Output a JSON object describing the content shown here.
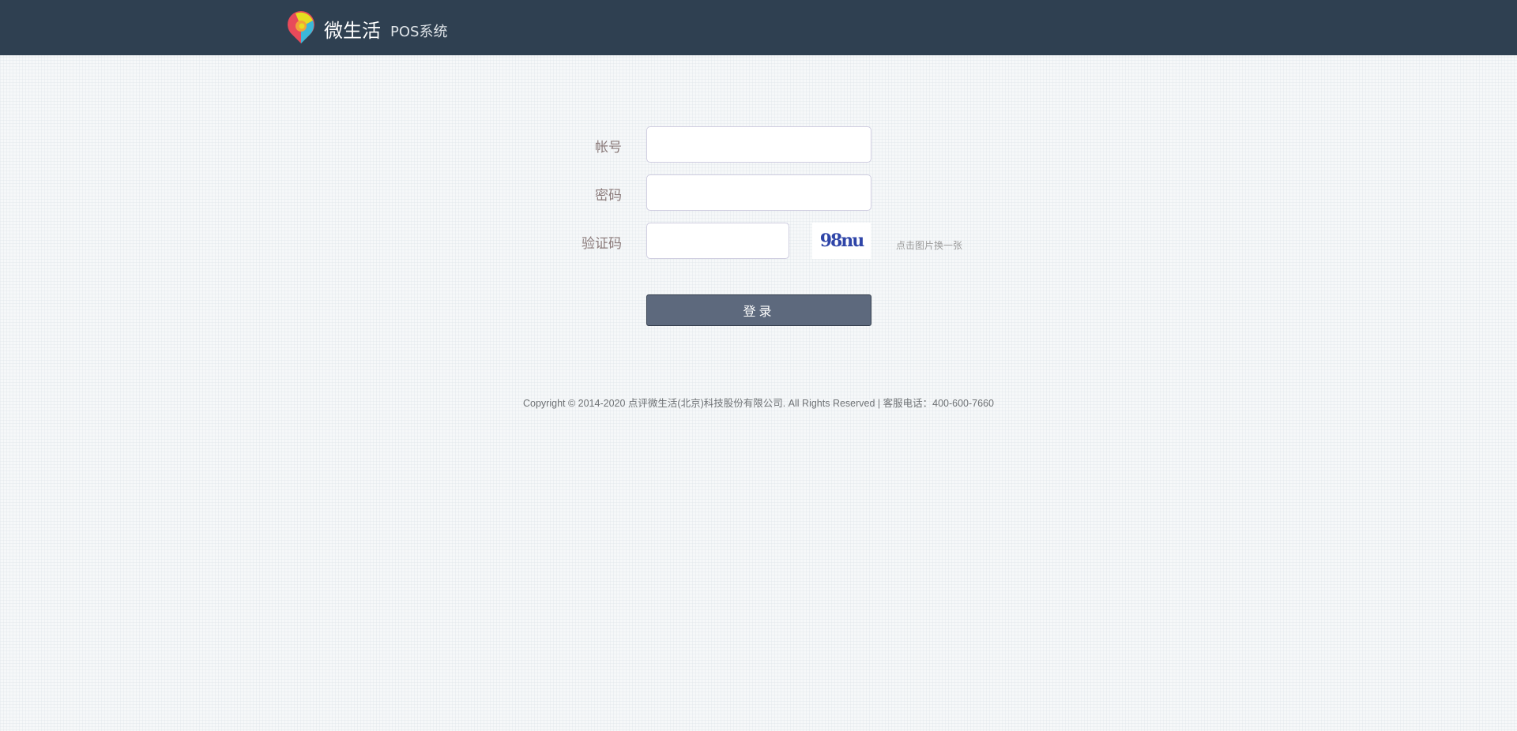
{
  "header": {
    "brand": "微生活",
    "subtitle": "POS系统"
  },
  "form": {
    "account_label": "帐号",
    "password_label": "密码",
    "captcha_label": "验证码",
    "account_value": "",
    "password_value": "",
    "captcha_value": "",
    "captcha_image_text": "98nu",
    "refresh_hint": "点击图片换一张",
    "login_label": "登录"
  },
  "footer": {
    "text": "Copyright © 2014-2020 点评微生活(北京)科技股份有限公司. All Rights Reserved | 客服电话：400-600-7660"
  }
}
